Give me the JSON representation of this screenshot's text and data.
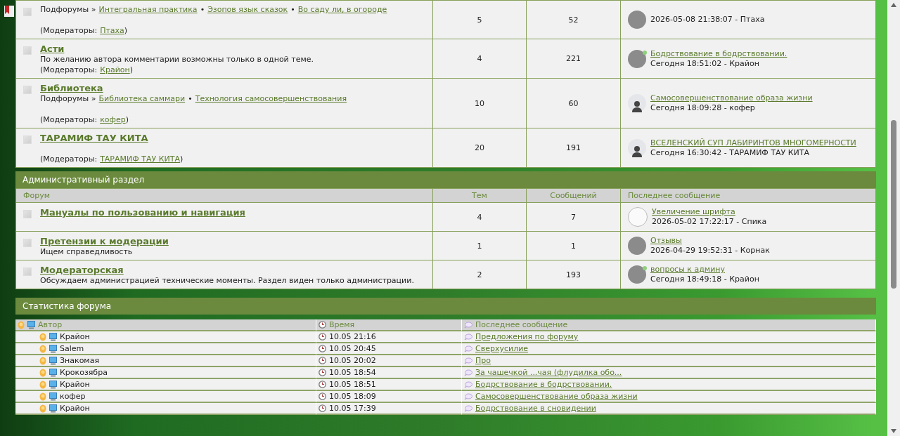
{
  "forums_top": {
    "rows": [
      {
        "subforums": {
          "label": "Подфорумы »",
          "separator": "•",
          "items": [
            "Интегральная практика",
            "Эзопов язык сказок",
            "Во саду ли, в огороде"
          ]
        },
        "moderators": {
          "prefix": "(Модераторы:",
          "names": [
            "Птаха"
          ],
          "suffix": ")"
        },
        "topics": "5",
        "posts": "52",
        "last": {
          "meta": "2026-05-08 21:38:07 - Птаха",
          "avatar": {
            "kind": "photo",
            "online": false
          }
        }
      },
      {
        "title": "Асти",
        "description": "По желанию автора комментарии возможны только в одной теме.",
        "moderators": {
          "prefix": "(Модераторы:",
          "names": [
            "Крайон"
          ],
          "suffix": ")"
        },
        "topics": "4",
        "posts": "221",
        "last": {
          "title": "Бодрствование в бодрствовании.",
          "meta": "Сегодня 18:51:02 - Крайон",
          "avatar": {
            "kind": "photo",
            "online": true
          }
        }
      },
      {
        "title": "Библиотека",
        "subforums": {
          "label": "Подфорумы »",
          "separator": "•",
          "items": [
            "Библиотека саммари",
            "Технология самосовершенствования"
          ]
        },
        "moderators": {
          "prefix": "(Модераторы:",
          "names": [
            "кофер"
          ],
          "suffix": ")"
        },
        "topics": "10",
        "posts": "60",
        "last": {
          "title": "Самосовершенствование образа жизни",
          "meta": "Сегодня 18:09:28 - кофер",
          "avatar": {
            "kind": "default",
            "online": false
          }
        }
      },
      {
        "title": "ТАРАМИФ ТАУ КИТА",
        "moderators": {
          "prefix": "(Модераторы:",
          "names": [
            "ТАРАМИФ ТАУ КИТА"
          ],
          "suffix": ")"
        },
        "topics": "20",
        "posts": "191",
        "last": {
          "title": "ВСЕЛЕНСКИЙ СУП ЛАБИРИНТОВ МНОГОМЕРНОСТИ",
          "meta": "Сегодня 16:30:42 - ТАРАМИФ ТАУ КИТА",
          "avatar": {
            "kind": "default",
            "online": false
          }
        }
      }
    ]
  },
  "admin_section": {
    "title": "Административный раздел",
    "columns": [
      "Форум",
      "Тем",
      "Сообщений",
      "Последнее сообщение"
    ],
    "rows": [
      {
        "title": "Мануалы по пользованию и навигация",
        "topics": "4",
        "posts": "7",
        "last": {
          "title": "Увеличение шрифта",
          "meta": "2026-05-02 17:22:17 - Спика",
          "avatar": {
            "kind": "sketch",
            "online": false
          }
        }
      },
      {
        "title": "Претензии к модерации",
        "description": "Ищем справедливость",
        "topics": "1",
        "posts": "1",
        "last": {
          "title": "Отзывы",
          "meta": "2026-04-29 19:52:31 - Корнак",
          "avatar": {
            "kind": "photo",
            "online": false
          }
        }
      },
      {
        "title": "Модераторская",
        "description": "Обсуждаем администрацией технические моменты. Раздел виден только администрации.",
        "topics": "2",
        "posts": "193",
        "last": {
          "title": "вопросы к админу",
          "meta": "Сегодня 18:49:18 - Крайон",
          "avatar": {
            "kind": "photo",
            "online": true
          }
        }
      }
    ]
  },
  "stats": {
    "title": "Статистика форума",
    "columns": [
      "Автор",
      "Время",
      "Последнее сообщение"
    ],
    "rows": [
      {
        "author": "Крайон",
        "time": "10.05 21:16",
        "topic": "Предложения по форуму"
      },
      {
        "author": "Salem",
        "time": "10.05 20:45",
        "topic": "Сверхусилие"
      },
      {
        "author": "Знакомая",
        "time": "10.05 20:02",
        "topic": "Про"
      },
      {
        "author": "Крокозябра",
        "time": "10.05 18:54",
        "topic": "За чашечкой ...чая (флудилка обо..."
      },
      {
        "author": "Крайон",
        "time": "10.05 18:51",
        "topic": "Бодрствование в бодрствовании."
      },
      {
        "author": "кофер",
        "time": "10.05 18:09",
        "topic": "Самосовершенствование образа жизни"
      },
      {
        "author": "Крайон",
        "time": "10.05 17:39",
        "topic": "Бодрствование в сновидении"
      }
    ]
  }
}
